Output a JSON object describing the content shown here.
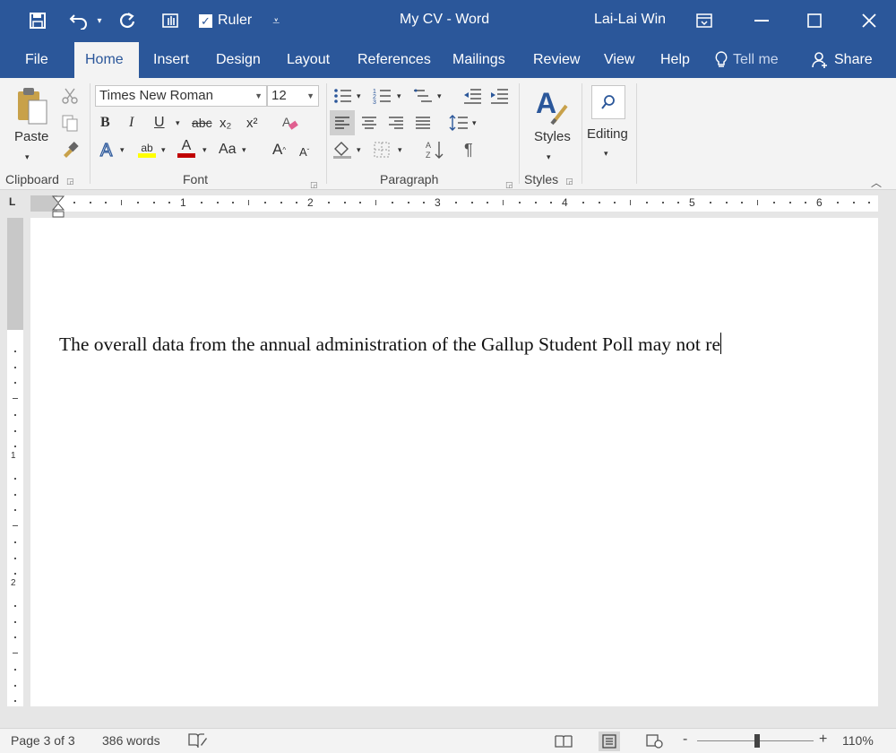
{
  "titlebar": {
    "ruler_label": "Ruler",
    "document_title": "My CV  -  Word",
    "user_name": "Lai-Lai Win"
  },
  "tabs": [
    {
      "label": "File"
    },
    {
      "label": "Home"
    },
    {
      "label": "Insert"
    },
    {
      "label": "Design"
    },
    {
      "label": "Layout"
    },
    {
      "label": "References"
    },
    {
      "label": "Mailings"
    },
    {
      "label": "Review"
    },
    {
      "label": "View"
    },
    {
      "label": "Help"
    }
  ],
  "tell_me": "Tell me",
  "share": "Share",
  "ribbon": {
    "clipboard": {
      "paste_label": "Paste",
      "group_label": "Clipboard"
    },
    "font": {
      "family": "Times New Roman",
      "size": "12",
      "group_label": "Font",
      "bold": "B",
      "italic": "I",
      "underline": "U",
      "strike": "abc",
      "subscript": "x₂",
      "superscript": "x²",
      "change_case": "Aa",
      "highlight": "ab",
      "font_color": "A",
      "grow": "A",
      "shrink": "A"
    },
    "paragraph": {
      "group_label": "Paragraph",
      "pilcrow": "¶"
    },
    "styles": {
      "label": "Styles",
      "group_label": "Styles"
    },
    "editing": {
      "label": "Editing"
    }
  },
  "ruler": {
    "numbers": [
      "1",
      "2",
      "3",
      "4",
      "5",
      "6"
    ],
    "vnumbers": [
      "1",
      "2"
    ],
    "tab_selector": "L"
  },
  "document": {
    "text": "The overall data from the annual administration of the Gallup Student Poll may not re"
  },
  "status": {
    "page": "Page 3 of 3",
    "words": "386 words",
    "zoom": "110%",
    "zoom_minus": "-",
    "zoom_plus": "+"
  },
  "colors": {
    "accent": "#2b579a",
    "ribbon": "#f3f3f3",
    "canvas": "#e6e6e6"
  }
}
